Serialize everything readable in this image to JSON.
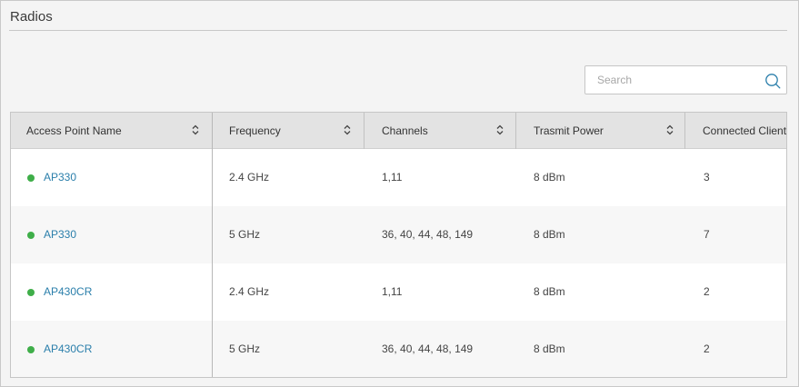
{
  "section": {
    "title": "Radios"
  },
  "search": {
    "placeholder": "Search",
    "value": ""
  },
  "table": {
    "columns": [
      "Access Point Name",
      "Frequency",
      "Channels",
      "Trasmit Power",
      "Connected Clients"
    ],
    "rows": [
      {
        "name": "AP330",
        "frequency": "2.4 GHz",
        "channels": "1,11",
        "power": "8 dBm",
        "clients": "3",
        "status": "online"
      },
      {
        "name": "AP330",
        "frequency": "5 GHz",
        "channels": "36, 40, 44, 48, 149",
        "power": "8 dBm",
        "clients": "7",
        "status": "online"
      },
      {
        "name": "AP430CR",
        "frequency": "2.4 GHz",
        "channels": "1,11",
        "power": "8 dBm",
        "clients": "2",
        "status": "online"
      },
      {
        "name": "AP430CR",
        "frequency": "5 GHz",
        "channels": "36, 40, 44, 48, 149",
        "power": "8 dBm",
        "clients": "2",
        "status": "online"
      }
    ]
  },
  "colors": {
    "status_online": "#3fae49",
    "link": "#2b7fab",
    "header_bg": "#e3e3e3"
  },
  "icons": {
    "search": "search-icon",
    "sort": "sort-icon",
    "status": "status-dot-icon"
  }
}
